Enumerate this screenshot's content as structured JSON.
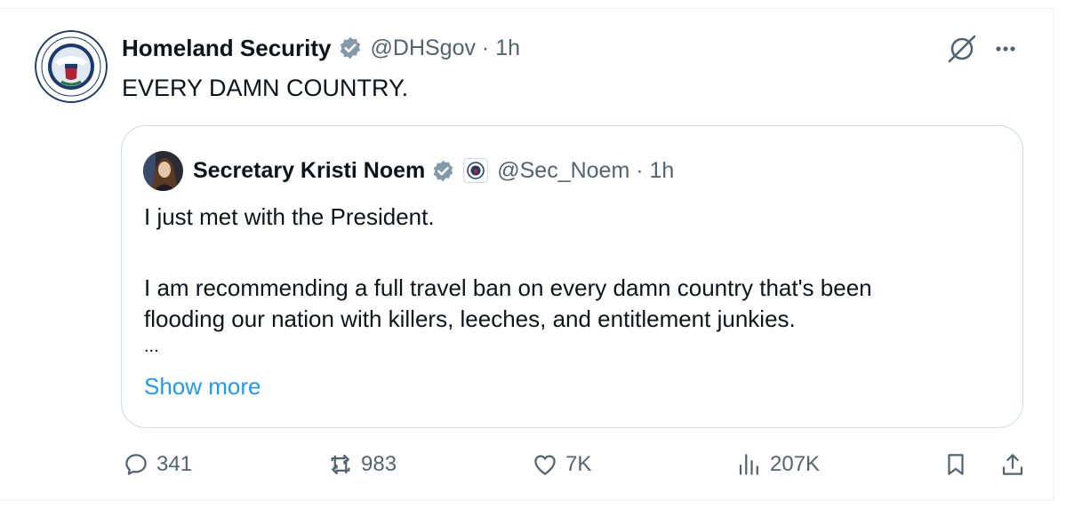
{
  "tweet": {
    "author_name": "Homeland Security",
    "handle_time": "@DHSgov · 1h",
    "text": "EVERY DAMN COUNTRY.",
    "avatar_icon": "dhs-seal-icon",
    "verified_color": "#829aab"
  },
  "quote": {
    "author_name": "Secretary Kristi Noem",
    "handle_time": "@Sec_Noem · 1h",
    "lines": [
      "I just met with the President.",
      "I am recommending a full travel ban on every damn country that's been",
      "flooding our nation with killers, leeches, and entitlement junkies.",
      "..."
    ],
    "show_more": "Show more"
  },
  "actions": {
    "replies": "341",
    "reposts": "983",
    "likes": "7K",
    "views": "207K"
  },
  "colors": {
    "link": "#1d9bf0",
    "secondary": "#536471",
    "border": "#cfd9de"
  }
}
